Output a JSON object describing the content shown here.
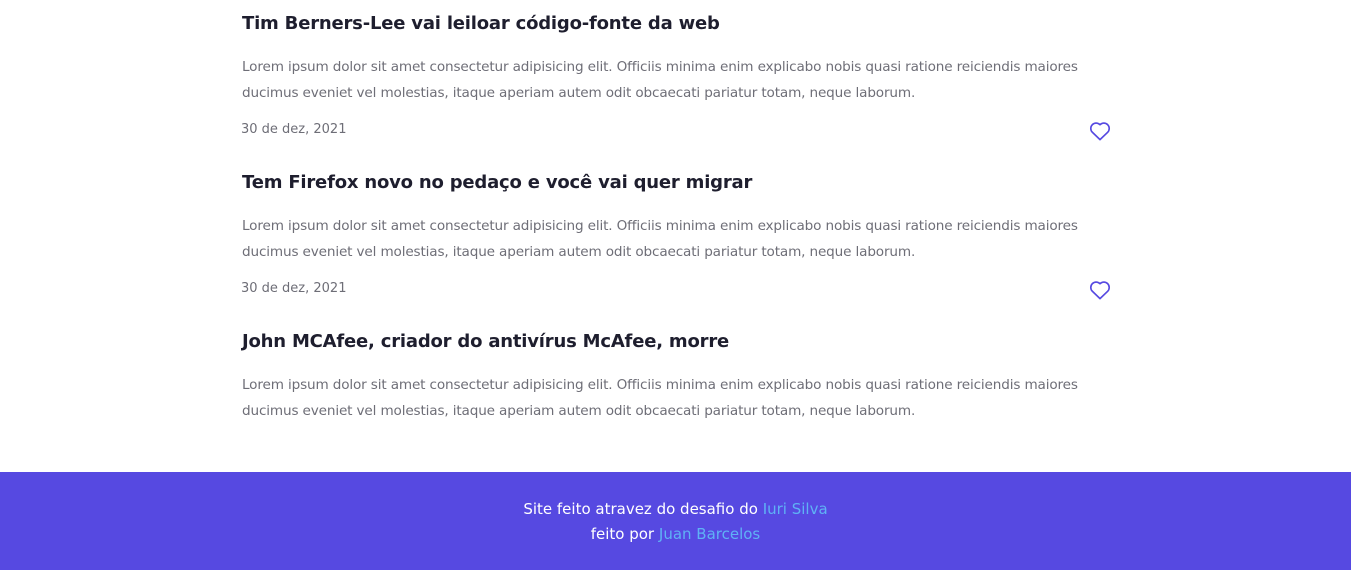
{
  "posts": [
    {
      "title": "Tim Berners-Lee vai leiloar código-fonte da web",
      "body": "Lorem ipsum dolor sit amet consectetur adipisicing elit. Officiis minima enim explicabo nobis quasi ratione reiciendis maiores ducimus eveniet vel molestias, itaque aperiam autem odit obcaecati pariatur totam, neque laborum.",
      "date": "30 de dez, 2021",
      "like_icon": "heart-outline-icon"
    },
    {
      "title": "Tem Firefox novo no pedaço e você vai quer migrar",
      "body": "Lorem ipsum dolor sit amet consectetur adipisicing elit. Officiis minima enim explicabo nobis quasi ratione reiciendis maiores ducimus eveniet vel molestias, itaque aperiam autem odit obcaecati pariatur totam, neque laborum.",
      "date": "30 de dez, 2021",
      "like_icon": "heart-outline-icon"
    },
    {
      "title": "John MCAfee, criador do antivírus McAfee, morre",
      "body": "Lorem ipsum dolor sit amet consectetur adipisicing elit. Officiis minima enim explicabo nobis quasi ratione reiciendis maiores ducimus eveniet vel molestias, itaque aperiam autem odit obcaecati pariatur totam, neque laborum."
    }
  ],
  "footer": {
    "line1_text": "Site feito atravez do desafio do",
    "line1_link": "Iuri Silva",
    "line2_text": "feito por",
    "line2_link": "Juan Barcelos"
  },
  "colors": {
    "accent": "#5649e1",
    "link": "#5fb2f5",
    "title": "#1e1e2e",
    "body_text": "#6e6e77",
    "heart": "#5649e1"
  }
}
